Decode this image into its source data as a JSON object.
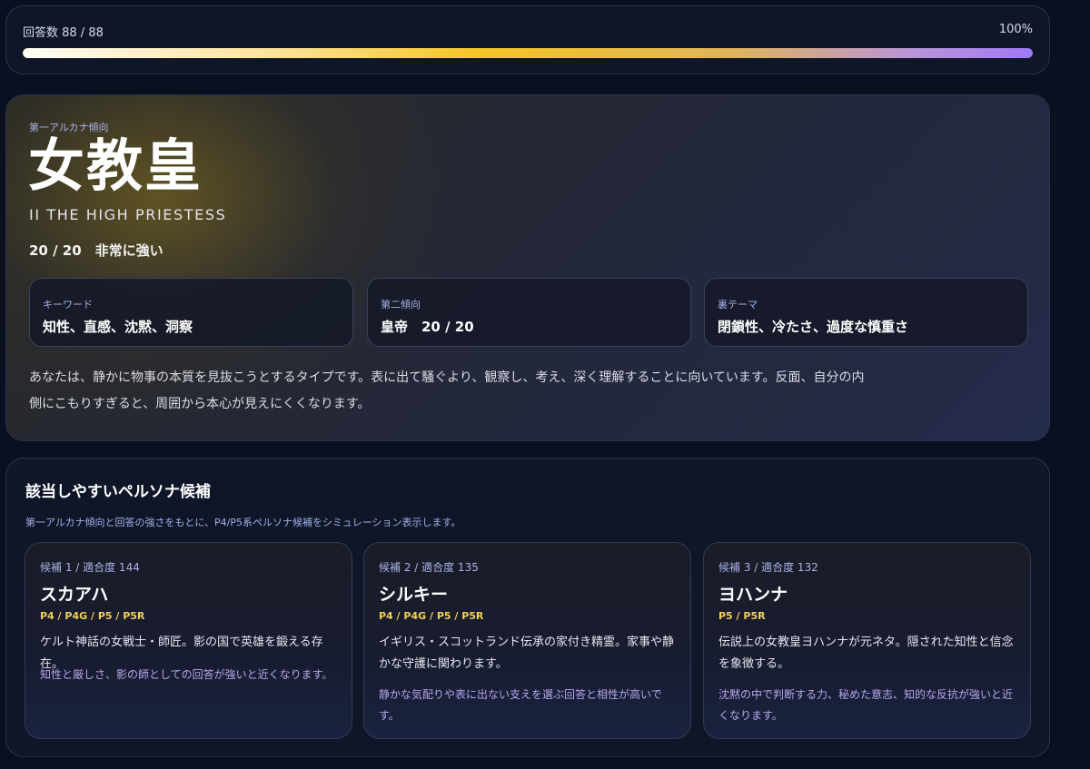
{
  "progress": {
    "label": "回答数 88 / 88",
    "percent_text": "100%",
    "value": 1.0
  },
  "result": {
    "arcana_label": "第一アルカナ傾向",
    "arcana_name": "女教皇",
    "arcana_en": "II THE HIGH PRIESTESS",
    "score_text": "20 / 20　非常に強い",
    "boxes": [
      {
        "label": "キーワード",
        "value": "知性、直感、沈黙、洞察"
      },
      {
        "label": "第二傾向",
        "value": "皇帝　20 / 20"
      },
      {
        "label": "裏テーマ",
        "value": "閉鎖性、冷たさ、過度な慎重さ"
      }
    ],
    "description": "あなたは、静かに物事の本質を見抜こうとするタイプです。表に出て騒ぐより、観察し、考え、深く理解することに向いています。反面、自分の内側にこもりすぎると、周囲から本心が見えにくくなります。"
  },
  "persona": {
    "title": "該当しやすいペルソナ候補",
    "subtitle": "第一アルカナ傾向と回答の強さをもとに、P4/P5系ペルソナ候補をシミュレーション表示します。",
    "cards": [
      {
        "meta": "候補 1 / 適合度 144",
        "name": "スカアハ",
        "games": "P4 / P4G / P5 / P5R",
        "desc": "ケルト神話の女戦士・師匠。影の国で英雄を鍛える存在。",
        "note": "知性と厳しさ、影の師としての回答が強いと近くなります。"
      },
      {
        "meta": "候補 2 / 適合度 135",
        "name": "シルキー",
        "games": "P4 / P4G / P5 / P5R",
        "desc": "イギリス・スコットランド伝承の家付き精霊。家事や静かな守護に関わります。",
        "note": "静かな気配りや表に出ない支えを選ぶ回答と相性が高いです。"
      },
      {
        "meta": "候補 3 / 適合度 132",
        "name": "ヨハンナ",
        "games": "P5 / P5R",
        "desc": "伝説上の女教皇ヨハンナが元ネタ。隠された知性と信念を象徴する。",
        "note": "沈黙の中で判断する力、秘めた意志、知的な反抗が強いと近くなります。"
      }
    ]
  },
  "colors": {
    "background": "#0a1020",
    "accent_gold": "#f3cf5c",
    "accent_purple": "#a07af5",
    "label_blue": "#a9b3e8"
  }
}
